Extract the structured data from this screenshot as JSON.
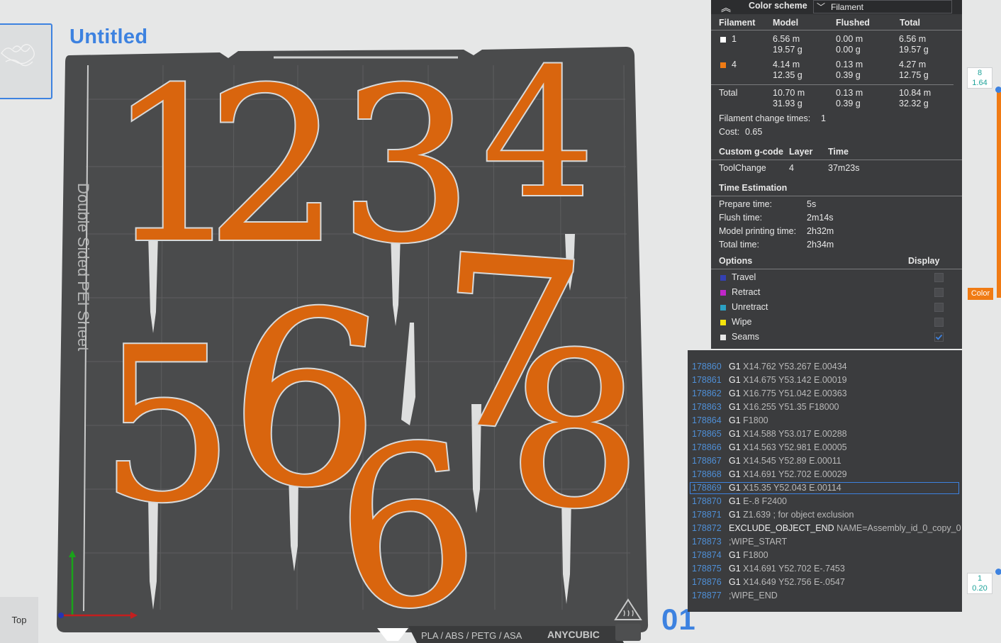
{
  "project": {
    "title": "Untitled"
  },
  "bed": {
    "side_label": "Double Sided PEI Sheet",
    "material_label": "PLA / ABS / PETG / ASA",
    "brand_label": "ANYCUBIC",
    "plate_number": "01"
  },
  "models": {
    "digits": [
      "1",
      "2",
      "3",
      "4",
      "5",
      "6",
      "6",
      "7",
      "8"
    ],
    "color": "#d9650e"
  },
  "view": {
    "top_button": "Top"
  },
  "legend": {
    "color_scheme_label": "Color scheme",
    "color_scheme_value": "Filament",
    "columns": [
      "Filament",
      "Model",
      "Flushed",
      "Total"
    ],
    "rows": [
      {
        "id": "1",
        "swatch": "#ffffff",
        "model_m": "6.56 m",
        "model_g": "19.57 g",
        "flushed_m": "0.00 m",
        "flushed_g": "0.00 g",
        "total_m": "6.56 m",
        "total_g": "19.57 g"
      },
      {
        "id": "4",
        "swatch": "#f07b14",
        "model_m": "4.14 m",
        "model_g": "12.35 g",
        "flushed_m": "0.13 m",
        "flushed_g": "0.39 g",
        "total_m": "4.27 m",
        "total_g": "12.75 g"
      }
    ],
    "total": {
      "label": "Total",
      "model_m": "10.70 m",
      "model_g": "31.93 g",
      "flushed_m": "0.13 m",
      "flushed_g": "0.39 g",
      "total_m": "10.84 m",
      "total_g": "32.32 g"
    },
    "filament_change_label": "Filament change times:",
    "filament_change_value": "1",
    "cost_label": "Cost:",
    "cost_value": "0.65",
    "custom_gcode_header": [
      "Custom g-code",
      "Layer",
      "Time"
    ],
    "custom_gcode_row": [
      "ToolChange",
      "4",
      "37m23s"
    ],
    "time_estimation_header": "Time Estimation",
    "times": [
      {
        "label": "Prepare time:",
        "value": "5s"
      },
      {
        "label": "Flush time:",
        "value": "2m14s"
      },
      {
        "label": "Model printing time:",
        "value": "2h32m"
      },
      {
        "label": "Total time:",
        "value": "2h34m"
      }
    ],
    "options_header": "Options",
    "display_header": "Display",
    "options": [
      {
        "label": "Travel",
        "color": "#3340b3",
        "checked": false
      },
      {
        "label": "Retract",
        "color": "#c026c9",
        "checked": false
      },
      {
        "label": "Unretract",
        "color": "#2ba1c4",
        "checked": false
      },
      {
        "label": "Wipe",
        "color": "#f5e30c",
        "checked": false
      },
      {
        "label": "Seams",
        "color": "#e6e6e6",
        "checked": true
      }
    ]
  },
  "gcode": {
    "selected_index": 9,
    "lines": [
      {
        "num": "178860",
        "cmd": "G1",
        "args": "X14.762 Y53.267 E.00434"
      },
      {
        "num": "178861",
        "cmd": "G1",
        "args": "X14.675 Y53.142 E.00019"
      },
      {
        "num": "178862",
        "cmd": "G1",
        "args": "X16.775 Y51.042 E.00363"
      },
      {
        "num": "178863",
        "cmd": "G1",
        "args": "X16.255 Y51.35 F18000"
      },
      {
        "num": "178864",
        "cmd": "G1",
        "args": "F1800"
      },
      {
        "num": "178865",
        "cmd": "G1",
        "args": "X14.588 Y53.017 E.00288"
      },
      {
        "num": "178866",
        "cmd": "G1",
        "args": "X14.563 Y52.981 E.00005"
      },
      {
        "num": "178867",
        "cmd": "G1",
        "args": "X14.545 Y52.89 E.00011"
      },
      {
        "num": "178868",
        "cmd": "G1",
        "args": "X14.691 Y52.702 E.00029"
      },
      {
        "num": "178869",
        "cmd": "G1",
        "args": "X15.35 Y52.043 E.00114"
      },
      {
        "num": "178870",
        "cmd": "G1",
        "args": "E-.8 F2400"
      },
      {
        "num": "178871",
        "cmd": "G1",
        "args": "Z1.639 ; for object exclusion"
      },
      {
        "num": "178872",
        "cmd": "EXCLUDE_OBJECT_END",
        "args": "NAME=Assembly_id_0_copy_0"
      },
      {
        "num": "178873",
        "cmd": "",
        "args": ";WIPE_START"
      },
      {
        "num": "178874",
        "cmd": "G1",
        "args": "F1800"
      },
      {
        "num": "178875",
        "cmd": "G1",
        "args": "X14.691 Y52.702 E-.7453"
      },
      {
        "num": "178876",
        "cmd": "G1",
        "args": "X14.649 Y52.756 E-.0547"
      },
      {
        "num": "178877",
        "cmd": "",
        "args": ";WIPE_END"
      }
    ]
  },
  "layer_slider": {
    "top_layer": "8",
    "top_height": "1.64",
    "bottom_layer": "1",
    "bottom_height": "0.20",
    "color_tag": "Color"
  }
}
